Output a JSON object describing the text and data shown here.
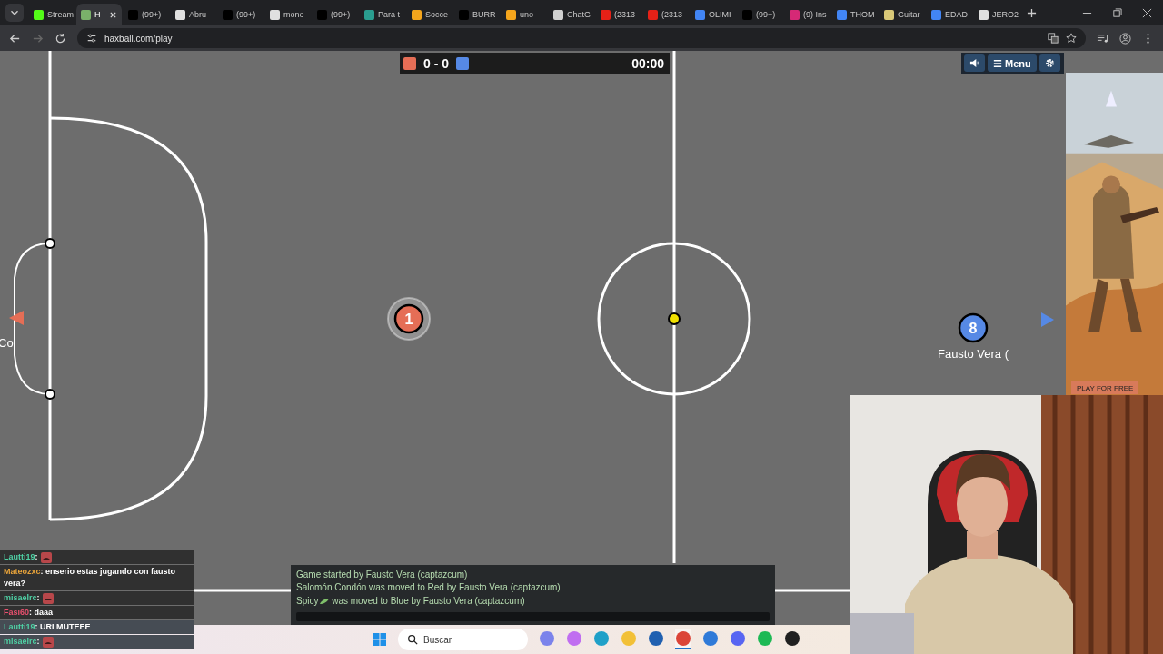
{
  "browser": {
    "tabs": [
      {
        "title": "Stream",
        "color": "#53fc18",
        "selected": false
      },
      {
        "title": "H",
        "color": "#7ab06a",
        "selected": true
      },
      {
        "title": "(99+)",
        "color": "#000000",
        "selected": false
      },
      {
        "title": "Abru",
        "color": "#e0e0e0",
        "selected": false
      },
      {
        "title": "(99+)",
        "color": "#000000",
        "selected": false
      },
      {
        "title": "mono",
        "color": "#e0e0e0",
        "selected": false
      },
      {
        "title": "(99+)",
        "color": "#000000",
        "selected": false
      },
      {
        "title": "Para t",
        "color": "#2a9d8f",
        "selected": false
      },
      {
        "title": "Socce",
        "color": "#f4a51c",
        "selected": false
      },
      {
        "title": "BURR",
        "color": "#000000",
        "selected": false
      },
      {
        "title": "uno -",
        "color": "#f4a51c",
        "selected": false
      },
      {
        "title": "ChatG",
        "color": "#d0d0d0",
        "selected": false
      },
      {
        "title": "(2313",
        "color": "#e62117",
        "selected": false
      },
      {
        "title": "(2313",
        "color": "#e62117",
        "selected": false
      },
      {
        "title": "OLIMI",
        "color": "#4285f4",
        "selected": false
      },
      {
        "title": "(99+)",
        "color": "#000000",
        "selected": false
      },
      {
        "title": "(9) Ins",
        "color": "#d62976",
        "selected": false
      },
      {
        "title": "THOM",
        "color": "#4285f4",
        "selected": false
      },
      {
        "title": "Guitar",
        "color": "#d8c878",
        "selected": false
      },
      {
        "title": "EDAD",
        "color": "#4285f4",
        "selected": false
      },
      {
        "title": "JERO2",
        "color": "#e0e0e0",
        "selected": false
      }
    ],
    "address": "haxball.com/play"
  },
  "game": {
    "score": "0 - 0",
    "time": "00:00",
    "menu": [
      {
        "kind": "sound"
      },
      {
        "kind": "menu",
        "label": "Menu"
      },
      {
        "kind": "settings"
      }
    ],
    "edge_name": "Co",
    "players": [
      {
        "number": "1",
        "color": "#e56e56",
        "controlled": true
      },
      {
        "number": "8",
        "color": "#5689e5",
        "controlled": false,
        "name": "Fausto Vera ("
      }
    ],
    "chat": [
      {
        "text": "Game started by Fausto Vera (captazcum)"
      },
      {
        "text": "Salomón Condón was moved to Red by Fausto Vera (captazcum)"
      },
      {
        "name": "Spicy",
        "text": "was moved to Blue by Fausto Vera (captazcum)"
      }
    ]
  },
  "ad": {
    "button": "PLAY FOR FREE"
  },
  "stream_chat": [
    {
      "user": "Lautti19",
      "color": "#4fd1a5",
      "text": ":",
      "kind": "emote"
    },
    {
      "user": "Mateozxc",
      "color": "#e8a33a",
      "text": ": enserio estas jugando con fausto vera?",
      "kind": "text"
    },
    {
      "user": "misaelrc",
      "color": "#4fd1a5",
      "text": ":",
      "kind": "emote"
    },
    {
      "user": "Fasi60",
      "color": "#e8506e",
      "text": ": daaa",
      "kind": "text"
    },
    {
      "user": "Lautti19",
      "color": "#4fd1a5",
      "text": ": URI MUTEEE",
      "kind": "text"
    },
    {
      "user": "misaelrc",
      "color": "#4fd1a5",
      "text": ":",
      "kind": "emote"
    }
  ],
  "taskbar": {
    "search_placeholder": "Buscar",
    "apps": [
      {
        "color": "#7b83eb",
        "selected": false
      },
      {
        "color": "#c06ef0",
        "selected": false
      },
      {
        "color": "#1fa0c8",
        "selected": false
      },
      {
        "color": "#f2c037",
        "selected": false
      },
      {
        "color": "#2060b0",
        "selected": false
      },
      {
        "color": "#db4437",
        "selected": true
      },
      {
        "color": "#2f7ad8",
        "selected": false
      },
      {
        "color": "#5865f2",
        "selected": false
      },
      {
        "color": "#1db954",
        "selected": false
      },
      {
        "color": "#202020",
        "selected": false
      }
    ]
  }
}
